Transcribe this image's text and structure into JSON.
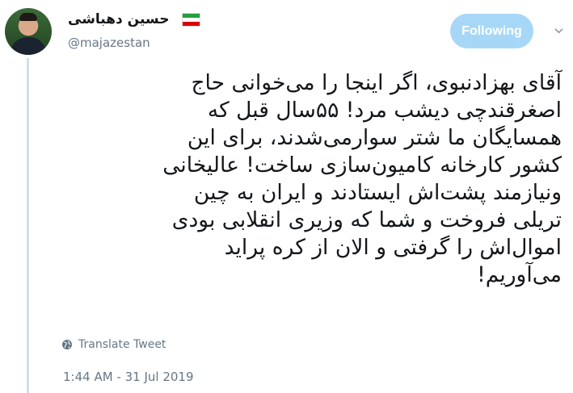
{
  "user": {
    "display_name": "حسین دهباشی",
    "handle": "@majazestan"
  },
  "flag_colors": [
    "#239f40",
    "#ffffff",
    "#da0000"
  ],
  "follow_button": {
    "label": "Following",
    "color": "#a7d7f6"
  },
  "tweet": {
    "lines": [
      "آقای بهزادنبوی، اگر اینجا را می‌خوانی حاج",
      "اصغرقندچی دیشب مرد! ۵۵سال قبل که",
      "همسایگان ما شتر سوارمی‌شدند، برای این",
      "کشور کارخانه کامیون‌سازی ساخت! عالیخانی",
      "ونیازمند پشت‌اش ایستادند و ایران به چین",
      "تریلی فروخت و شما که وزیری انقلابی بودی",
      "اموال‌اش را گرفتی و الان از کره پراید",
      "می‌آوریم!"
    ]
  },
  "translate": {
    "label": "Translate Tweet",
    "icon": "globe-icon"
  },
  "timestamp": "1:44 AM - 31 Jul 2019"
}
